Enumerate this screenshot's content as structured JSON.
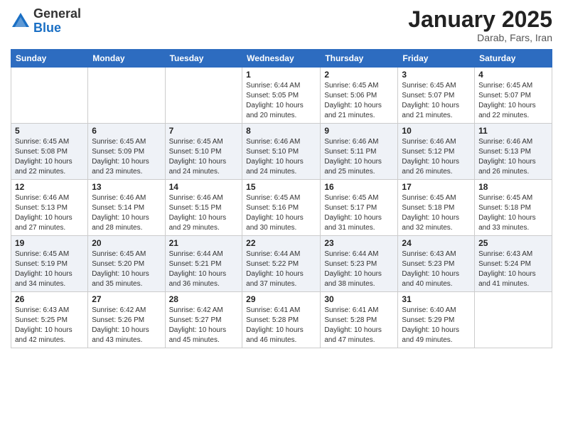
{
  "logo": {
    "general": "General",
    "blue": "Blue"
  },
  "header": {
    "month": "January 2025",
    "location": "Darab, Fars, Iran"
  },
  "weekdays": [
    "Sunday",
    "Monday",
    "Tuesday",
    "Wednesday",
    "Thursday",
    "Friday",
    "Saturday"
  ],
  "weeks": [
    [
      {
        "day": "",
        "sunrise": "",
        "sunset": "",
        "daylight": ""
      },
      {
        "day": "",
        "sunrise": "",
        "sunset": "",
        "daylight": ""
      },
      {
        "day": "",
        "sunrise": "",
        "sunset": "",
        "daylight": ""
      },
      {
        "day": "1",
        "sunrise": "Sunrise: 6:44 AM",
        "sunset": "Sunset: 5:05 PM",
        "daylight": "Daylight: 10 hours and 20 minutes."
      },
      {
        "day": "2",
        "sunrise": "Sunrise: 6:45 AM",
        "sunset": "Sunset: 5:06 PM",
        "daylight": "Daylight: 10 hours and 21 minutes."
      },
      {
        "day": "3",
        "sunrise": "Sunrise: 6:45 AM",
        "sunset": "Sunset: 5:07 PM",
        "daylight": "Daylight: 10 hours and 21 minutes."
      },
      {
        "day": "4",
        "sunrise": "Sunrise: 6:45 AM",
        "sunset": "Sunset: 5:07 PM",
        "daylight": "Daylight: 10 hours and 22 minutes."
      }
    ],
    [
      {
        "day": "5",
        "sunrise": "Sunrise: 6:45 AM",
        "sunset": "Sunset: 5:08 PM",
        "daylight": "Daylight: 10 hours and 22 minutes."
      },
      {
        "day": "6",
        "sunrise": "Sunrise: 6:45 AM",
        "sunset": "Sunset: 5:09 PM",
        "daylight": "Daylight: 10 hours and 23 minutes."
      },
      {
        "day": "7",
        "sunrise": "Sunrise: 6:45 AM",
        "sunset": "Sunset: 5:10 PM",
        "daylight": "Daylight: 10 hours and 24 minutes."
      },
      {
        "day": "8",
        "sunrise": "Sunrise: 6:46 AM",
        "sunset": "Sunset: 5:10 PM",
        "daylight": "Daylight: 10 hours and 24 minutes."
      },
      {
        "day": "9",
        "sunrise": "Sunrise: 6:46 AM",
        "sunset": "Sunset: 5:11 PM",
        "daylight": "Daylight: 10 hours and 25 minutes."
      },
      {
        "day": "10",
        "sunrise": "Sunrise: 6:46 AM",
        "sunset": "Sunset: 5:12 PM",
        "daylight": "Daylight: 10 hours and 26 minutes."
      },
      {
        "day": "11",
        "sunrise": "Sunrise: 6:46 AM",
        "sunset": "Sunset: 5:13 PM",
        "daylight": "Daylight: 10 hours and 26 minutes."
      }
    ],
    [
      {
        "day": "12",
        "sunrise": "Sunrise: 6:46 AM",
        "sunset": "Sunset: 5:13 PM",
        "daylight": "Daylight: 10 hours and 27 minutes."
      },
      {
        "day": "13",
        "sunrise": "Sunrise: 6:46 AM",
        "sunset": "Sunset: 5:14 PM",
        "daylight": "Daylight: 10 hours and 28 minutes."
      },
      {
        "day": "14",
        "sunrise": "Sunrise: 6:46 AM",
        "sunset": "Sunset: 5:15 PM",
        "daylight": "Daylight: 10 hours and 29 minutes."
      },
      {
        "day": "15",
        "sunrise": "Sunrise: 6:45 AM",
        "sunset": "Sunset: 5:16 PM",
        "daylight": "Daylight: 10 hours and 30 minutes."
      },
      {
        "day": "16",
        "sunrise": "Sunrise: 6:45 AM",
        "sunset": "Sunset: 5:17 PM",
        "daylight": "Daylight: 10 hours and 31 minutes."
      },
      {
        "day": "17",
        "sunrise": "Sunrise: 6:45 AM",
        "sunset": "Sunset: 5:18 PM",
        "daylight": "Daylight: 10 hours and 32 minutes."
      },
      {
        "day": "18",
        "sunrise": "Sunrise: 6:45 AM",
        "sunset": "Sunset: 5:18 PM",
        "daylight": "Daylight: 10 hours and 33 minutes."
      }
    ],
    [
      {
        "day": "19",
        "sunrise": "Sunrise: 6:45 AM",
        "sunset": "Sunset: 5:19 PM",
        "daylight": "Daylight: 10 hours and 34 minutes."
      },
      {
        "day": "20",
        "sunrise": "Sunrise: 6:45 AM",
        "sunset": "Sunset: 5:20 PM",
        "daylight": "Daylight: 10 hours and 35 minutes."
      },
      {
        "day": "21",
        "sunrise": "Sunrise: 6:44 AM",
        "sunset": "Sunset: 5:21 PM",
        "daylight": "Daylight: 10 hours and 36 minutes."
      },
      {
        "day": "22",
        "sunrise": "Sunrise: 6:44 AM",
        "sunset": "Sunset: 5:22 PM",
        "daylight": "Daylight: 10 hours and 37 minutes."
      },
      {
        "day": "23",
        "sunrise": "Sunrise: 6:44 AM",
        "sunset": "Sunset: 5:23 PM",
        "daylight": "Daylight: 10 hours and 38 minutes."
      },
      {
        "day": "24",
        "sunrise": "Sunrise: 6:43 AM",
        "sunset": "Sunset: 5:23 PM",
        "daylight": "Daylight: 10 hours and 40 minutes."
      },
      {
        "day": "25",
        "sunrise": "Sunrise: 6:43 AM",
        "sunset": "Sunset: 5:24 PM",
        "daylight": "Daylight: 10 hours and 41 minutes."
      }
    ],
    [
      {
        "day": "26",
        "sunrise": "Sunrise: 6:43 AM",
        "sunset": "Sunset: 5:25 PM",
        "daylight": "Daylight: 10 hours and 42 minutes."
      },
      {
        "day": "27",
        "sunrise": "Sunrise: 6:42 AM",
        "sunset": "Sunset: 5:26 PM",
        "daylight": "Daylight: 10 hours and 43 minutes."
      },
      {
        "day": "28",
        "sunrise": "Sunrise: 6:42 AM",
        "sunset": "Sunset: 5:27 PM",
        "daylight": "Daylight: 10 hours and 45 minutes."
      },
      {
        "day": "29",
        "sunrise": "Sunrise: 6:41 AM",
        "sunset": "Sunset: 5:28 PM",
        "daylight": "Daylight: 10 hours and 46 minutes."
      },
      {
        "day": "30",
        "sunrise": "Sunrise: 6:41 AM",
        "sunset": "Sunset: 5:28 PM",
        "daylight": "Daylight: 10 hours and 47 minutes."
      },
      {
        "day": "31",
        "sunrise": "Sunrise: 6:40 AM",
        "sunset": "Sunset: 5:29 PM",
        "daylight": "Daylight: 10 hours and 49 minutes."
      },
      {
        "day": "",
        "sunrise": "",
        "sunset": "",
        "daylight": ""
      }
    ]
  ]
}
